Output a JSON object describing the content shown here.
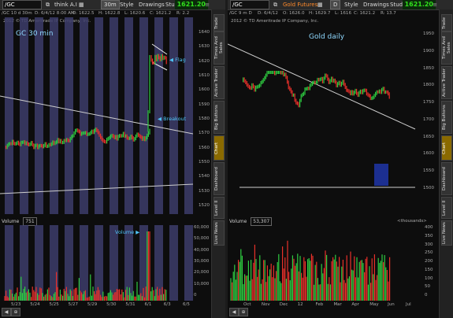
{
  "left": {
    "toolbar": {
      "symbol": "/GC",
      "study_set": "think A.I",
      "timeframe": "30m",
      "style_label": "Style",
      "drawings_label": "Drawings",
      "studies_label": "Studies"
    },
    "last_price": "1621.20",
    "info": {
      "symbol_tf": "/GC 10 d 30m",
      "date": "D: 6/4/12 8:00 AM",
      "open": "O: 1622.5",
      "high": "H: 1622.8",
      "low": "L: 1620.6",
      "close": "C: 1621.2",
      "range": "R: 2.2"
    },
    "copyright": "2012 © TD Ameritrade IP Company, Inc.",
    "title": "GC 30 min",
    "annotations": {
      "flag": "Flag",
      "breakout": "Breakout",
      "volume": "Volume"
    },
    "price_axis": [
      "1640",
      "1630",
      "1620",
      "1610",
      "1600",
      "1590",
      "1580",
      "1570",
      "1560",
      "1550",
      "1540",
      "1530",
      "1520"
    ],
    "volume_header": {
      "label": "Volume",
      "value": "751"
    },
    "volume_axis": [
      "60,000",
      "50,000",
      "40,000",
      "30,000",
      "20,000",
      "10,000",
      "0"
    ],
    "x_axis": [
      "5/23",
      "5/24",
      "5/25",
      "5/27",
      "5/29",
      "5/30",
      "5/31",
      "6/1",
      "6/3",
      "6/5"
    ],
    "side_tabs": [
      "Trade",
      "Times And Sales",
      "Active Trader",
      "Big Buttons",
      "Chart",
      "Dashboard",
      "Level II",
      "Live News"
    ]
  },
  "right": {
    "toolbar": {
      "symbol": "/GC",
      "study_set": "Gold Futures",
      "timeframe": "D",
      "style_label": "Style",
      "drawings_label": "Drawings",
      "studies_label": "Studies"
    },
    "last_price": "1621.20",
    "info": {
      "symbol_tf": "/GC 9 m D",
      "date": "D: 6/4/12",
      "open": "O: 1626.0",
      "high": "H: 1629.7",
      "low": "L: 1616",
      "close": "C: 1621.2",
      "range": "R: 13.7"
    },
    "copyright": "2012 © TD Ameritrade IP Company, Inc.",
    "title": "Gold daily",
    "price_axis": [
      "1950",
      "1900",
      "1850",
      "1800",
      "1750",
      "1700",
      "1650",
      "1600",
      "1550",
      "1500"
    ],
    "volume_header": {
      "label": "Volume",
      "value": "53,307"
    },
    "thousands": "<thousands>",
    "volume_axis": [
      "400",
      "350",
      "300",
      "250",
      "200",
      "150",
      "100",
      "50",
      "0"
    ],
    "x_axis": [
      "Oct",
      "Nov",
      "Dec",
      "12",
      "Feb",
      "Mar",
      "Apr",
      "May",
      "Jun",
      "Jul"
    ],
    "side_tabs": [
      "Trade",
      "Times And Sales",
      "Active Trader",
      "Big Buttons",
      "Chart",
      "Dashboard",
      "Level II",
      "Live News"
    ]
  },
  "colors": {
    "up": "#2ecc40",
    "down": "#e8302a",
    "accent": "#4fc3f7",
    "price": "#31e01c",
    "session_band": "#3d3d6b"
  }
}
